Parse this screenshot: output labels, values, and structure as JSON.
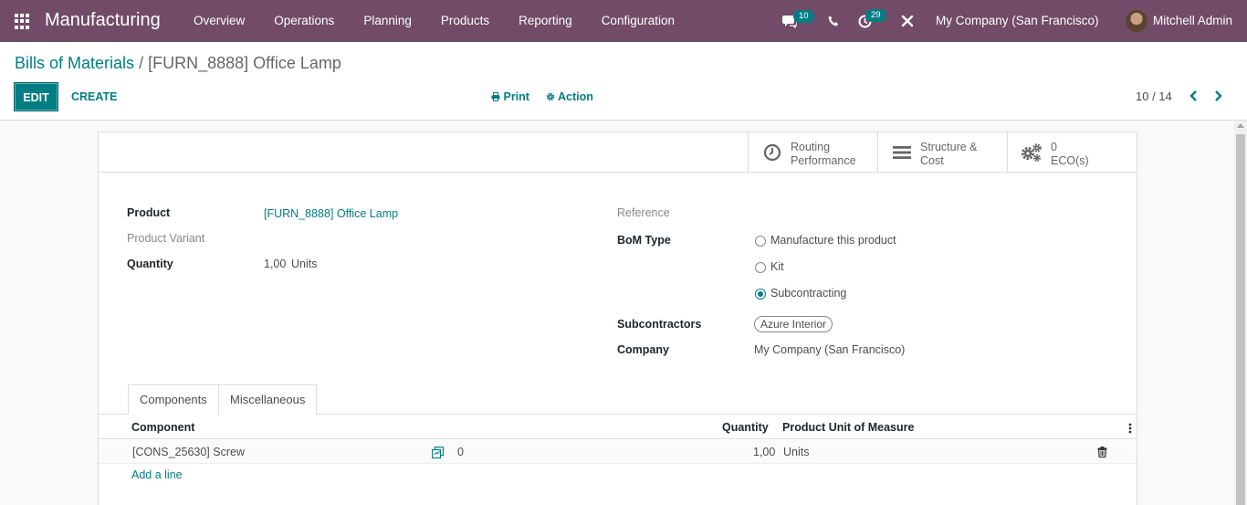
{
  "navbar": {
    "app_name": "Manufacturing",
    "menu": [
      "Overview",
      "Operations",
      "Planning",
      "Products",
      "Reporting",
      "Configuration"
    ],
    "messages_count": "10",
    "activities_count": "29",
    "company": "My Company (San Francisco)",
    "user": "Mitchell Admin"
  },
  "control": {
    "breadcrumb_parent": "Bills of Materials",
    "breadcrumb_sep": "/",
    "breadcrumb_current": "[FURN_8888] Office Lamp",
    "edit_label": "EDIT",
    "create_label": "CREATE",
    "print_label": "Print",
    "action_label": "Action",
    "pager": "10 / 14"
  },
  "stat_buttons": {
    "routing_l1": "Routing",
    "routing_l2": "Performance",
    "structure_l1": "Structure &",
    "structure_l2": "Cost",
    "eco_count": "0",
    "eco_label": "ECO(s)"
  },
  "form": {
    "product_label": "Product",
    "product_value": "[FURN_8888] Office Lamp",
    "variant_label": "Product Variant",
    "quantity_label": "Quantity",
    "quantity_value": "1,00",
    "quantity_uom": "Units",
    "reference_label": "Reference",
    "bom_type_label": "BoM Type",
    "bom_types": [
      "Manufacture this product",
      "Kit",
      "Subcontracting"
    ],
    "bom_type_selected": "Subcontracting",
    "subcontractors_label": "Subcontractors",
    "subcontractor_tag": "Azure Interior",
    "company_label": "Company",
    "company_value": "My Company (San Francisco)"
  },
  "tabs": {
    "components": "Components",
    "misc": "Miscellaneous"
  },
  "table": {
    "headers": {
      "component": "Component",
      "quantity": "Quantity",
      "uom": "Product Unit of Measure"
    },
    "rows": [
      {
        "component": "[CONS_25630] Screw",
        "avail": "0",
        "quantity": "1,00",
        "uom": "Units"
      }
    ],
    "add_line": "Add a line"
  },
  "colors": {
    "brand": "#714B67",
    "accent": "#017e84"
  }
}
